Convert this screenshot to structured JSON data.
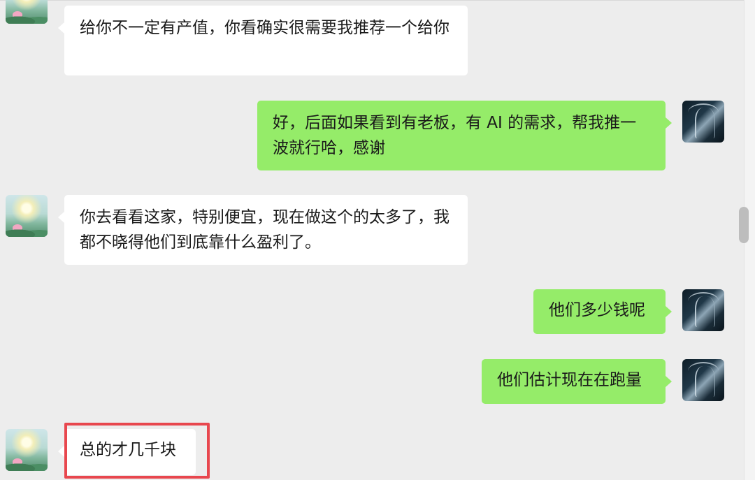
{
  "messages": [
    {
      "side": "in",
      "text": "给你不一定有产值，你看确实很需要我推荐一个给你"
    },
    {
      "side": "out",
      "text": "好，后面如果看到有老板，有 AI 的需求，帮我推一波就行哈，感谢"
    },
    {
      "side": "in",
      "text": "你去看看这家，特别便宜，现在做这个的太多了，我都不晓得他们到底靠什么盈利了。"
    },
    {
      "side": "out",
      "text": "他们多少钱呢"
    },
    {
      "side": "out",
      "text": "他们估计现在在跑量"
    },
    {
      "side": "in",
      "text": "总的才几千块"
    }
  ],
  "colors": {
    "background": "#ededed",
    "incoming_bubble": "#ffffff",
    "outgoing_bubble": "#95ec69",
    "highlight_border": "#e8474e"
  },
  "icons": {
    "incoming_avatar": "lotus-landscape-avatar",
    "outgoing_avatar": "dark-figure-avatar"
  }
}
